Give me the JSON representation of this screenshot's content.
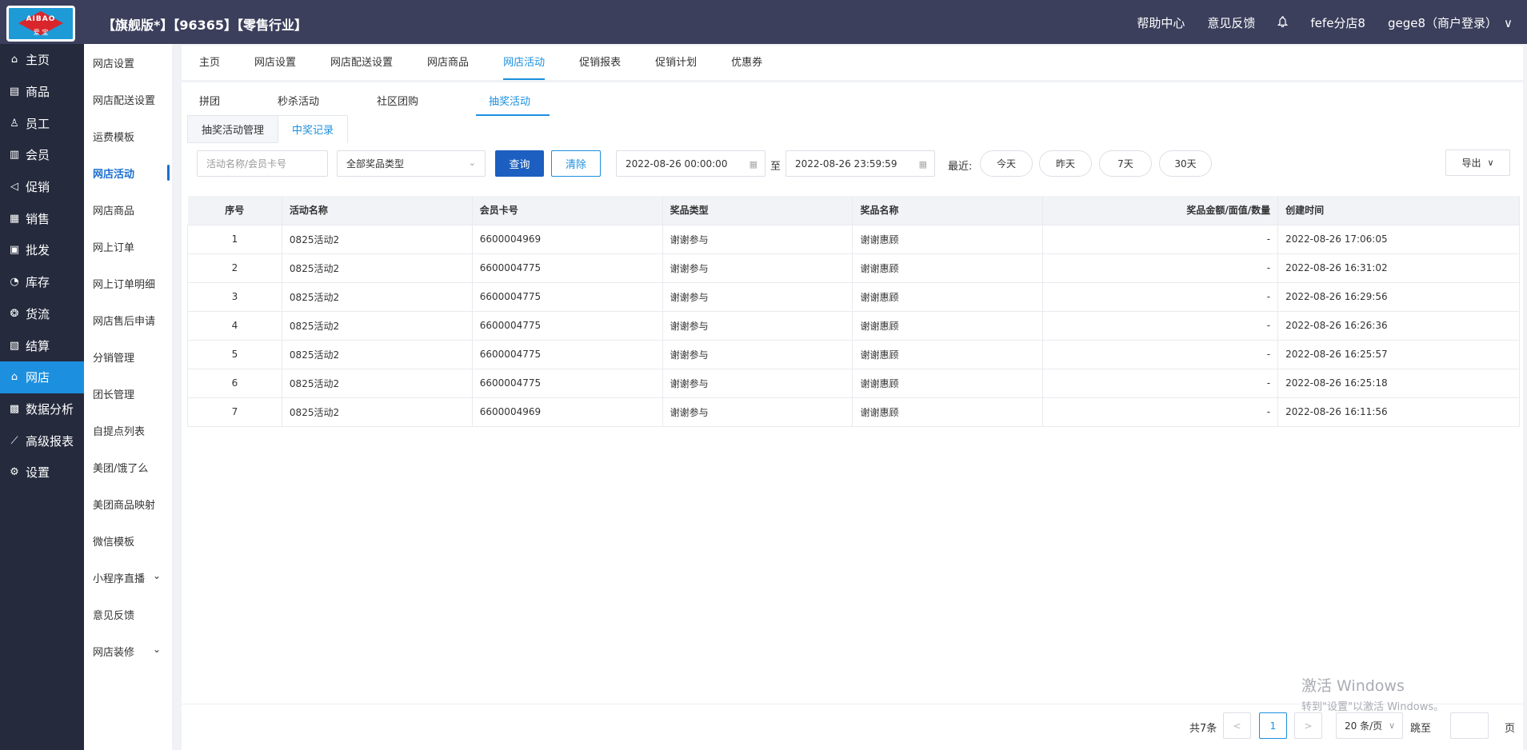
{
  "header": {
    "logo_text": "AIBAO",
    "logo_sub": "爱 宝",
    "store_title": "【旗舰版*】【96365】【零售行业】",
    "help": "帮助中心",
    "feedback": "意见反馈",
    "branch": "fefe分店8",
    "user": "gege8（商户登录）",
    "chevron": "∨"
  },
  "mainnav": [
    {
      "label": "主页",
      "icon": "⌂"
    },
    {
      "label": "商品",
      "icon": "▤"
    },
    {
      "label": "员工",
      "icon": "♙"
    },
    {
      "label": "会员",
      "icon": "▥"
    },
    {
      "label": "促销",
      "icon": "◁"
    },
    {
      "label": "销售",
      "icon": "▦"
    },
    {
      "label": "批发",
      "icon": "▣"
    },
    {
      "label": "库存",
      "icon": "◔"
    },
    {
      "label": "货流",
      "icon": "❂"
    },
    {
      "label": "结算",
      "icon": "▧"
    },
    {
      "label": "网店",
      "icon": "⌂"
    },
    {
      "label": "数据分析",
      "icon": "▩"
    },
    {
      "label": "高级报表",
      "icon": "⟋"
    },
    {
      "label": "设置",
      "icon": "⚙"
    }
  ],
  "subnav": [
    "网店设置",
    "网店配送设置",
    "运费模板",
    "网店活动",
    "网店商品",
    "网上订单",
    "网上订单明细",
    "网店售后申请",
    "分销管理",
    "团长管理",
    "自提点列表",
    "美团/饿了么",
    "美团商品映射",
    "微信模板",
    "小程序直播",
    "意见反馈",
    "网店装修"
  ],
  "subnav_arrow": "⌄",
  "tabs": [
    "主页",
    "网店设置",
    "网店配送设置",
    "网店商品",
    "网店活动",
    "促销报表",
    "促销计划",
    "优惠券"
  ],
  "subtabs": [
    "拼团",
    "秒杀活动",
    "社区团购",
    "抽奖活动"
  ],
  "cardtabs": [
    "抽奖活动管理",
    "中奖记录"
  ],
  "filter": {
    "search_placeholder": "活动名称/会员卡号",
    "prize_type": "全部奖品类型",
    "query": "查询",
    "clear": "清除",
    "start": "2022-08-26 00:00:00",
    "to": "至",
    "end": "2022-08-26 23:59:59",
    "recent": "最近:",
    "today": "今天",
    "yesterday": "昨天",
    "d7": "7天",
    "d30": "30天",
    "export": "导出"
  },
  "table": {
    "headers": [
      "序号",
      "活动名称",
      "会员卡号",
      "奖品类型",
      "奖品名称",
      "奖品金额/面值/数量",
      "创建时间"
    ],
    "rows": [
      [
        "1",
        "0825活动2",
        "6600004969",
        "谢谢参与",
        "谢谢惠顾",
        "-",
        "2022-08-26 17:06:05"
      ],
      [
        "2",
        "0825活动2",
        "6600004775",
        "谢谢参与",
        "谢谢惠顾",
        "-",
        "2022-08-26 16:31:02"
      ],
      [
        "3",
        "0825活动2",
        "6600004775",
        "谢谢参与",
        "谢谢惠顾",
        "-",
        "2022-08-26 16:29:56"
      ],
      [
        "4",
        "0825活动2",
        "6600004775",
        "谢谢参与",
        "谢谢惠顾",
        "-",
        "2022-08-26 16:26:36"
      ],
      [
        "5",
        "0825活动2",
        "6600004775",
        "谢谢参与",
        "谢谢惠顾",
        "-",
        "2022-08-26 16:25:57"
      ],
      [
        "6",
        "0825活动2",
        "6600004775",
        "谢谢参与",
        "谢谢惠顾",
        "-",
        "2022-08-26 16:25:18"
      ],
      [
        "7",
        "0825活动2",
        "6600004969",
        "谢谢参与",
        "谢谢惠顾",
        "-",
        "2022-08-26 16:11:56"
      ]
    ]
  },
  "pager": {
    "total": "共7条",
    "prev": "<",
    "page": "1",
    "next": ">",
    "size": "20 条/页",
    "goto": "跳至",
    "page_unit": "页"
  },
  "watermark": {
    "line1": "激活 Windows",
    "line2": "转到\"设置\"以激活 Windows。"
  },
  "colors": {
    "topbar": "#3b3f5c",
    "sidebar": "#252a3d",
    "accent": "#1c8fdf",
    "primary_button": "#1c5fc0"
  }
}
